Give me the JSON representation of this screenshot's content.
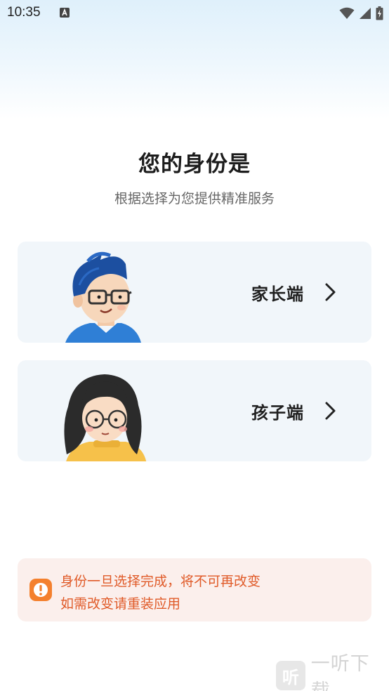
{
  "status_bar": {
    "time": "10:35"
  },
  "header": {
    "title": "您的身份是",
    "subtitle": "根据选择为您提供精准服务"
  },
  "roles": [
    {
      "label": "家长端",
      "avatar": "parent-avatar"
    },
    {
      "label": "孩子端",
      "avatar": "child-avatar"
    }
  ],
  "notice": {
    "line1": "身份一旦选择完成，将不可再改变",
    "line2": "如需改变请重装应用",
    "color": "#e05a28"
  },
  "watermark": {
    "logo": "听",
    "text": "一听下载"
  },
  "colors": {
    "card_bg": "#f1f6fa",
    "notice_bg": "#fbefec",
    "accent_orange": "#f4802d"
  }
}
